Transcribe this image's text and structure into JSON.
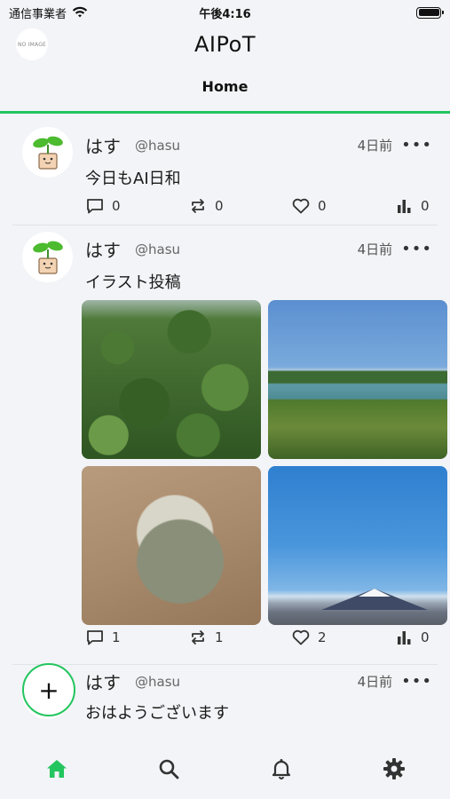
{
  "status_bar": {
    "carrier": "通信事業者",
    "time": "午後4:16"
  },
  "header": {
    "logo_text": "NO IMAGE",
    "title": "AIPoT",
    "tab_home": "Home"
  },
  "colors": {
    "accent": "#22c55e"
  },
  "posts": [
    {
      "user_name": "はす",
      "user_handle": "@hasu",
      "time": "4日前",
      "more": "•••",
      "text": "今日もAI日和",
      "reply_count": "0",
      "repost_count": "0",
      "like_count": "0",
      "view_count": "0"
    },
    {
      "user_name": "はす",
      "user_handle": "@hasu",
      "time": "4日前",
      "more": "•••",
      "text": "イラスト投稿",
      "reply_count": "1",
      "repost_count": "1",
      "like_count": "2",
      "view_count": "0"
    },
    {
      "user_name": "はす",
      "user_handle": "@hasu",
      "time": "4日前",
      "more": "•••",
      "text": "おはようございます"
    }
  ],
  "fab": {
    "label": "+"
  },
  "bottom_nav": {
    "icons": [
      "home-icon",
      "search-icon",
      "bell-icon",
      "gear-icon"
    ]
  }
}
